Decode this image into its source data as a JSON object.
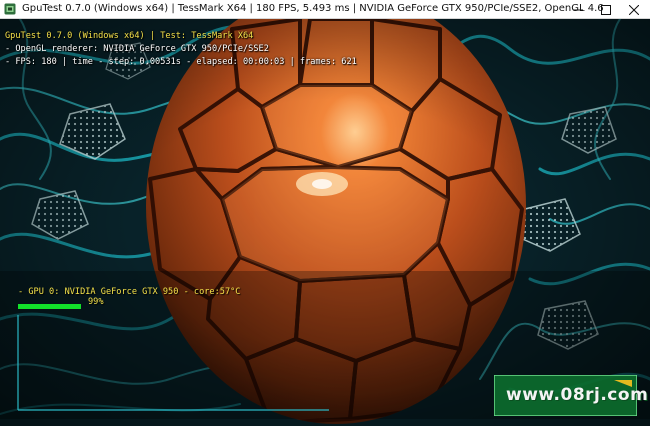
{
  "window": {
    "title": "GpuTest 0.7.0 (Windows x64) | TessMark X64 | 180 FPS, 5.493 ms | NVIDIA GeForce GTX 950/PCIe/SSE2, OpenGL 4.6",
    "controls": [
      "minimize-icon",
      "maximize-icon",
      "close-icon"
    ]
  },
  "hud": {
    "line1": "GpuTest 0.7.0 (Windows x64) | Test: TessMark X64",
    "line2": "- OpenGL renderer: NVIDIA GeForce GTX 950/PCIe/SSE2",
    "line3": "- FPS: 180 | time - step: 0.00531s - elapsed: 00:00:03 | frames: 621"
  },
  "gpu_monitor": {
    "label": "- GPU 0: NVIDIA GeForce GTX 950 - core:57°C",
    "usage_percent": 99,
    "usage_label": "99%",
    "bar_color": "#12e12a"
  },
  "watermark": {
    "text": "www.08rj.com"
  },
  "colors": {
    "hud_yellow": "#f3e04a",
    "sphere_orange": "#c8501c",
    "background_teal": "#1bb7c3"
  }
}
